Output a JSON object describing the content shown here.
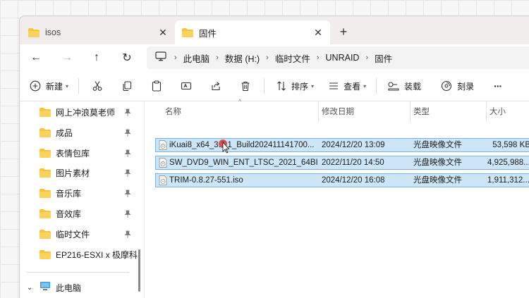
{
  "tabs": [
    {
      "label": "isos",
      "active": false
    },
    {
      "label": "固件",
      "active": true
    }
  ],
  "tab_close_glyph": "✕",
  "tab_add_glyph": "+",
  "nav": {
    "back": "←",
    "forward": "→",
    "up": "↑",
    "refresh": "↻"
  },
  "breadcrumbs": [
    "此电脑",
    "数据 (H:)",
    "临时文件",
    "UNRAID",
    "固件"
  ],
  "breadcrumb_sep": "›",
  "toolbar": {
    "new_label": "新建",
    "sort_label": "排序",
    "view_label": "查看",
    "mount_label": "装载",
    "burn_label": "刻录",
    "more_glyph": "···"
  },
  "sidebar": {
    "items": [
      {
        "label": "网上冲浪莫老师",
        "pinned": true
      },
      {
        "label": "成品",
        "pinned": true
      },
      {
        "label": "表情包库",
        "pinned": true
      },
      {
        "label": "图片素材",
        "pinned": true
      },
      {
        "label": "音乐库",
        "pinned": true
      },
      {
        "label": "音效库",
        "pinned": true
      },
      {
        "label": "临时文件",
        "pinned": true
      },
      {
        "label": "EP216-ESXI x 极摩科",
        "pinned": false
      }
    ],
    "this_pc": "此电脑"
  },
  "columns": {
    "name": "名称",
    "modified": "修改日期",
    "type": "类型",
    "size": "大小"
  },
  "files": [
    {
      "name": "iKuai8_x64_3.7.1_Build202411141700...",
      "modified": "2024/12/20 13:09",
      "type": "光盘映像文件",
      "size": "53,598 KB"
    },
    {
      "name": "SW_DVD9_WIN_ENT_LTSC_2021_64BI...",
      "modified": "2022/11/20 14:50",
      "type": "光盘映像文件",
      "size": "4,925,988..."
    },
    {
      "name": "TRIM-0.8.27-551.iso",
      "modified": "2024/12/20 16:08",
      "type": "光盘映像文件",
      "size": "1,911,312..."
    }
  ],
  "colors": {
    "folder_yellow": "#f8c33a",
    "selection_fill": "#cde6f7",
    "selection_border": "#7fb3de",
    "accent_blue": "#0067c0"
  }
}
